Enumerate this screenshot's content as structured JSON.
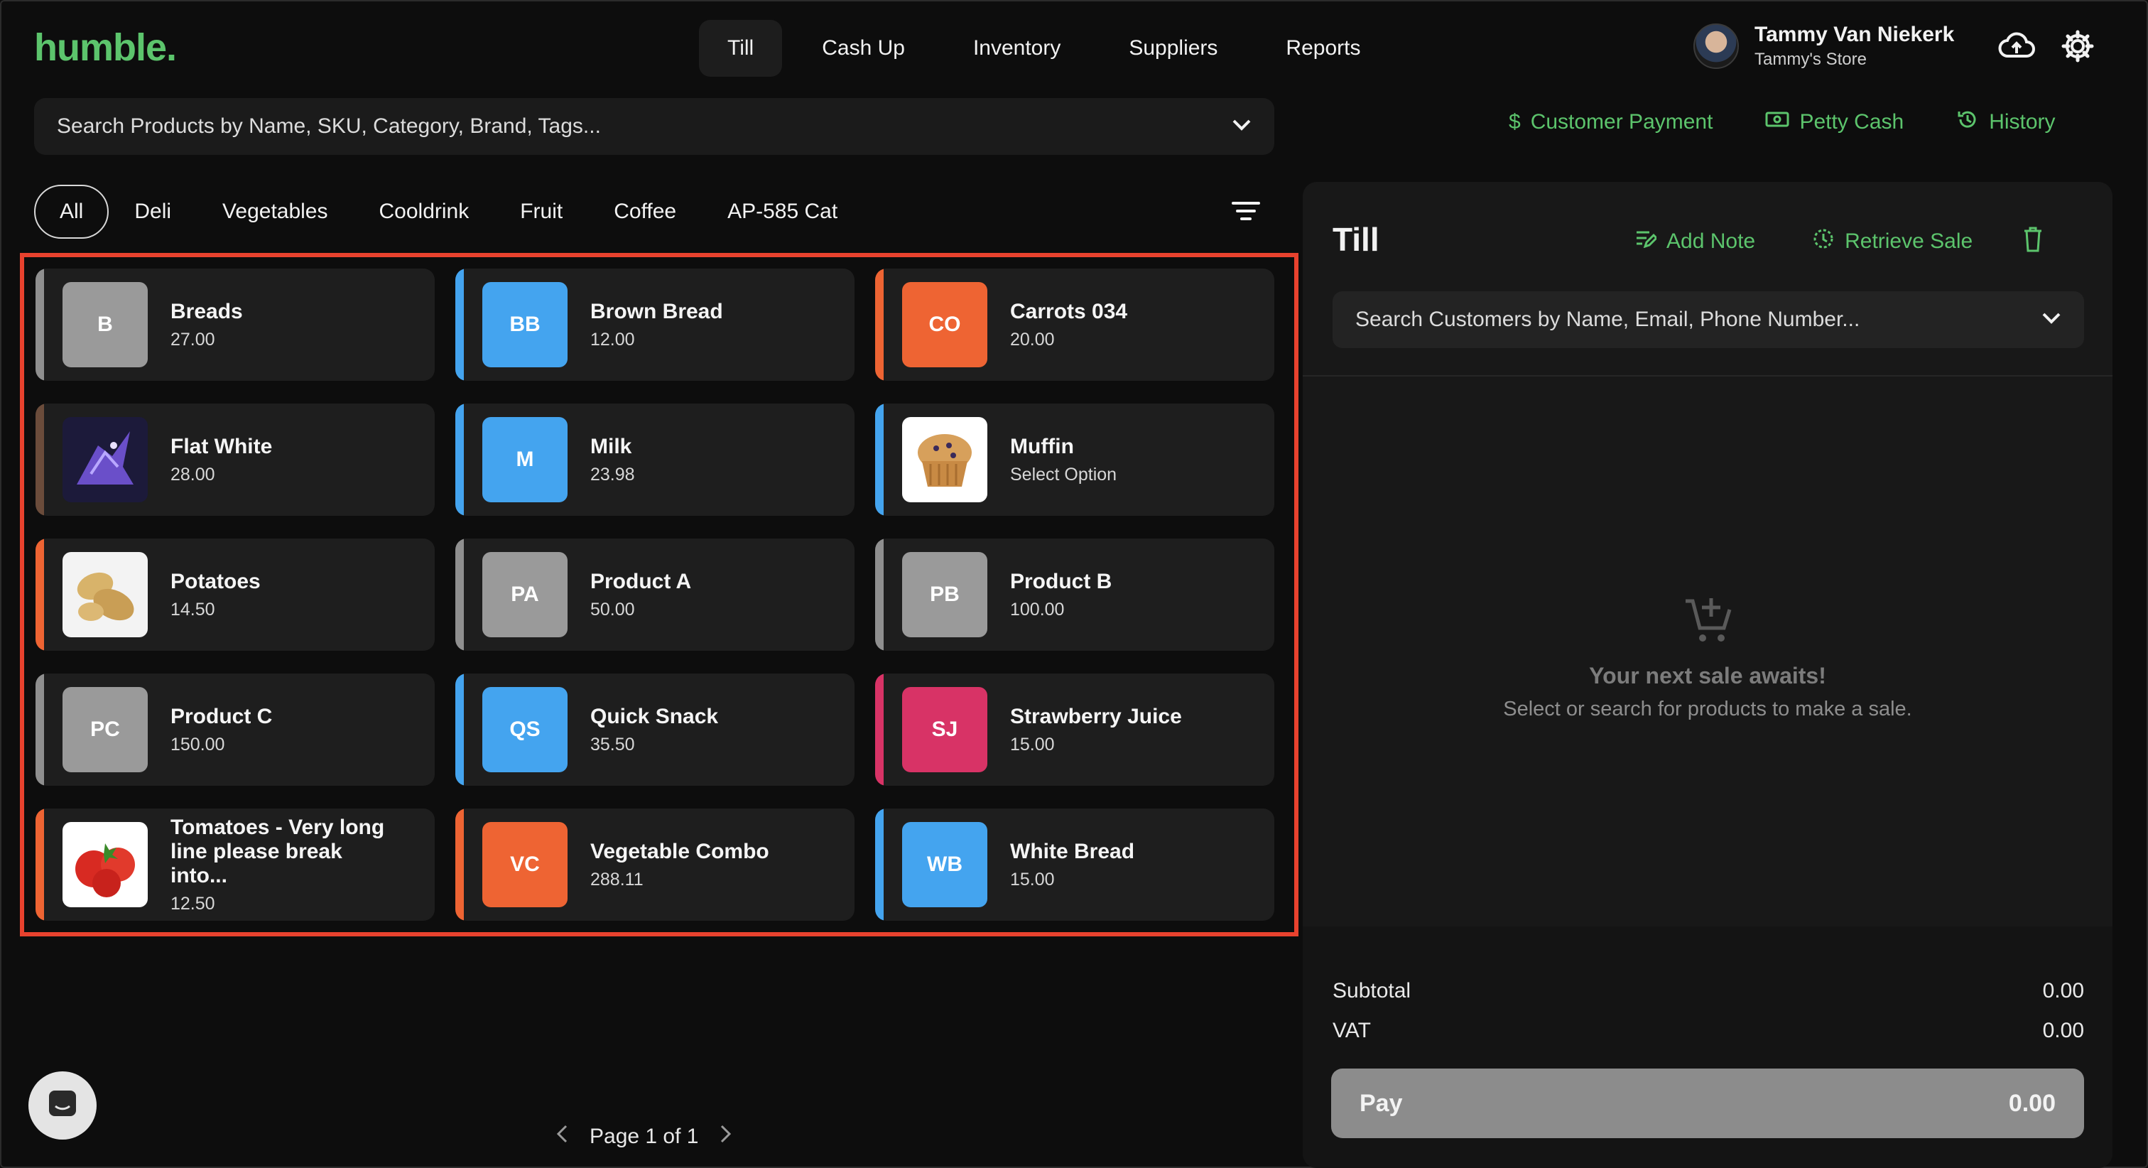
{
  "brand": {
    "logo": "humble."
  },
  "nav": {
    "tabs": [
      {
        "label": "Till",
        "active": true
      },
      {
        "label": "Cash Up"
      },
      {
        "label": "Inventory"
      },
      {
        "label": "Suppliers"
      },
      {
        "label": "Reports"
      }
    ]
  },
  "user": {
    "name": "Tammy Van Niekerk",
    "store": "Tammy's Store"
  },
  "icons": {
    "cloud": "cloud-upload-icon",
    "settings": "gear-icon",
    "chat": "chat-icon"
  },
  "search": {
    "placeholder": "Search Products by Name, SKU, Category, Brand, Tags..."
  },
  "actions": {
    "customer_payment": "Customer Payment",
    "petty_cash": "Petty Cash",
    "history": "History"
  },
  "categories": [
    {
      "label": "All",
      "active": true
    },
    {
      "label": "Deli"
    },
    {
      "label": "Vegetables"
    },
    {
      "label": "Cooldrink"
    },
    {
      "label": "Fruit"
    },
    {
      "label": "Coffee"
    },
    {
      "label": "AP-585 Cat"
    }
  ],
  "products": [
    {
      "name": "Breads",
      "price": "27.00",
      "initials": "B",
      "color": "#9a9a9a",
      "bar": "#8f8f8f"
    },
    {
      "name": "Brown Bread",
      "price": "12.00",
      "initials": "BB",
      "color": "#44a4ef",
      "bar": "#44a4ef"
    },
    {
      "name": "Carrots 034",
      "price": "20.00",
      "initials": "CO",
      "color": "#ee6433",
      "bar": "#ee6433"
    },
    {
      "name": "Flat White",
      "price": "28.00",
      "image": "dragon",
      "bar": "#6b4c3b"
    },
    {
      "name": "Milk",
      "price": "23.98",
      "initials": "M",
      "color": "#44a4ef",
      "bar": "#44a4ef"
    },
    {
      "name": "Muffin",
      "price": "Select Option",
      "image": "muffin",
      "bar": "#44a4ef"
    },
    {
      "name": "Potatoes",
      "price": "14.50",
      "image": "potatoes",
      "bar": "#ee6433"
    },
    {
      "name": "Product A",
      "price": "50.00",
      "initials": "PA",
      "color": "#9a9a9a",
      "bar": "#8f8f8f"
    },
    {
      "name": "Product B",
      "price": "100.00",
      "initials": "PB",
      "color": "#9a9a9a",
      "bar": "#8f8f8f"
    },
    {
      "name": "Product C",
      "price": "150.00",
      "initials": "PC",
      "color": "#9a9a9a",
      "bar": "#8f8f8f"
    },
    {
      "name": "Quick Snack",
      "price": "35.50",
      "initials": "QS",
      "color": "#44a4ef",
      "bar": "#44a4ef"
    },
    {
      "name": "Strawberry Juice",
      "price": "15.00",
      "initials": "SJ",
      "color": "#d83366",
      "bar": "#d83366"
    },
    {
      "name": "Tomatoes - Very long line please break into...",
      "price": "12.50",
      "image": "tomatoes",
      "bar": "#ee6433"
    },
    {
      "name": "Vegetable Combo",
      "price": "288.11",
      "initials": "VC",
      "color": "#ee6433",
      "bar": "#ee6433"
    },
    {
      "name": "White Bread",
      "price": "15.00",
      "initials": "WB",
      "color": "#44a4ef",
      "bar": "#44a4ef"
    }
  ],
  "pagination": {
    "label": "Page 1 of 1"
  },
  "till": {
    "title": "Till",
    "add_note": "Add Note",
    "retrieve_sale": "Retrieve Sale",
    "customer_search": "Search Customers by Name, Email, Phone Number...",
    "empty_title": "Your next sale awaits!",
    "empty_sub": "Select or search for products to make a sale.",
    "subtotal_label": "Subtotal",
    "subtotal": "0.00",
    "vat_label": "VAT",
    "vat": "0.00",
    "pay_label": "Pay",
    "pay_amount": "0.00"
  },
  "colors": {
    "accent": "#5cc46c",
    "highlight": "#e8422e"
  }
}
